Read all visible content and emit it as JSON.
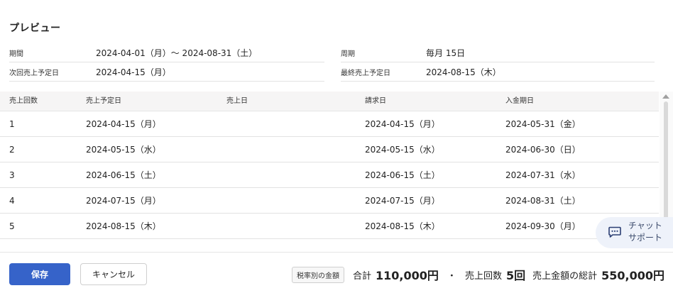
{
  "page": {
    "title": "プレビュー"
  },
  "summary": {
    "period_label": "期間",
    "period_value": "2024-04-01（月）～ 2024-08-31（土）",
    "cycle_label": "周期",
    "cycle_value": "毎月  15日",
    "next_sale_label": "次回売上予定日",
    "next_sale_value": "2024-04-15（月）",
    "last_sale_label": "最終売上予定日",
    "last_sale_value": "2024-08-15（木）"
  },
  "table": {
    "headers": [
      "売上回数",
      "売上予定日",
      "売上日",
      "請求日",
      "入金期日"
    ],
    "rows": [
      [
        "1",
        "2024-04-15（月）",
        "",
        "2024-04-15（月）",
        "2024-05-31（金）"
      ],
      [
        "2",
        "2024-05-15（水）",
        "",
        "2024-05-15（水）",
        "2024-06-30（日）"
      ],
      [
        "3",
        "2024-06-15（土）",
        "",
        "2024-06-15（土）",
        "2024-07-31（水）"
      ],
      [
        "4",
        "2024-07-15（月）",
        "",
        "2024-07-15（月）",
        "2024-08-31（土）"
      ],
      [
        "5",
        "2024-08-15（木）",
        "",
        "2024-08-15（木）",
        "2024-09-30（月）"
      ]
    ]
  },
  "footer": {
    "save_label": "保存",
    "cancel_label": "キャンセル",
    "tax_badge": "税率別の金額",
    "total_label": "合計",
    "total_value": "110,000円",
    "separator": "・",
    "count_label": "売上回数",
    "count_value": "5回",
    "grand_label": "売上金額の総計",
    "grand_value": "550,000円"
  },
  "chat": {
    "label_line1": "チャット",
    "label_line2": "サポート",
    "icon": "chat-bubble-icon"
  },
  "colors": {
    "primary": "#3663c9",
    "header_bg": "#f6f5f5",
    "chat_bg": "#eef2fa"
  }
}
